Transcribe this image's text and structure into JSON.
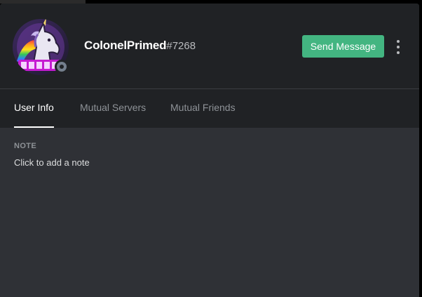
{
  "profile": {
    "username": "ColonelPrimed",
    "discriminator": "#7268",
    "status": "offline",
    "avatar_icon": "unicorn-avatar-icon",
    "send_message_label": "Send Message",
    "more_icon": "more-vertical-icon"
  },
  "tabs": [
    {
      "label": "User Info",
      "active": true
    },
    {
      "label": "Mutual Servers",
      "active": false
    },
    {
      "label": "Mutual Friends",
      "active": false
    }
  ],
  "note": {
    "heading": "NOTE",
    "placeholder": "Click to add a note"
  },
  "colors": {
    "header_bg": "#202225",
    "body_bg": "#2f3136",
    "accent_green": "#43b581",
    "status_offline": "#747f8d"
  }
}
